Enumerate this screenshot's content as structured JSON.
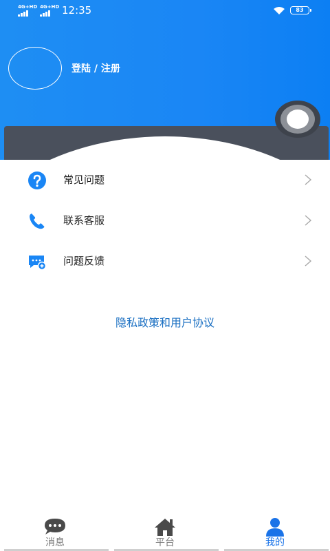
{
  "status_bar": {
    "signal_1": "4G+HD",
    "signal_2": "4G+HD",
    "time": "12:35",
    "battery": "83",
    "icons": [
      "signal-icon",
      "signal-icon",
      "wifi-icon",
      "battery-icon"
    ]
  },
  "header": {
    "login_label": "登陆 / 注册",
    "accent_color": "#1a86f5"
  },
  "menu": {
    "items": [
      {
        "label": "常见问题",
        "icon": "help-circle-icon"
      },
      {
        "label": "联系客服",
        "icon": "phone-icon"
      },
      {
        "label": "问题反馈",
        "icon": "feedback-icon"
      }
    ]
  },
  "privacy_link": "隐私政策和用户协议",
  "tabbar": {
    "tabs": [
      {
        "label": "消息",
        "icon": "chat-bubble-icon",
        "active": false
      },
      {
        "label": "平台",
        "icon": "home-icon",
        "active": false
      },
      {
        "label": "我的",
        "icon": "user-icon",
        "active": true
      }
    ],
    "active_color": "#1a73e8"
  }
}
